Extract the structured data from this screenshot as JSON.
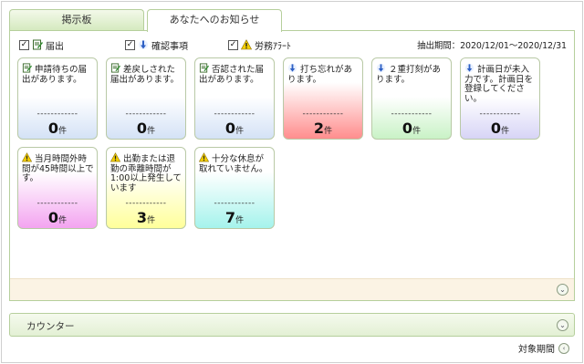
{
  "tabs": [
    {
      "label": "掲示板",
      "active": false
    },
    {
      "label": "あなたへのお知らせ",
      "active": true
    }
  ],
  "filters": [
    {
      "label": "届出",
      "checked": true,
      "icon": "notepad-icon"
    },
    {
      "label": "確認事項",
      "checked": true,
      "icon": "info-arrow-icon"
    },
    {
      "label": "労務ｱﾗｰﾄ",
      "checked": true,
      "icon": "warning-icon"
    }
  ],
  "period": "抽出期間：2020/12/01～2020/12/31",
  "cards": [
    {
      "icon": "notepad-icon",
      "message": "申請待ちの届出があります。",
      "dash": "------------",
      "count": "0",
      "unit": "件",
      "color": "#d4e2f6"
    },
    {
      "icon": "notepad-icon",
      "message": "差戻しされた届出があります。",
      "dash": "------------",
      "count": "0",
      "unit": "件",
      "color": "#d4e2f6"
    },
    {
      "icon": "notepad-icon",
      "message": "否認された届出があります。",
      "dash": "------------",
      "count": "0",
      "unit": "件",
      "color": "#d4e2f6"
    },
    {
      "icon": "info-arrow-icon",
      "message": "打ち忘れがあります。",
      "dash": "------------",
      "count": "2",
      "unit": "件",
      "color": "#ff8d8d"
    },
    {
      "icon": "info-arrow-icon",
      "message": "２重打刻があります。",
      "dash": "------------",
      "count": "0",
      "unit": "件",
      "color": "#c9f2c6"
    },
    {
      "icon": "info-arrow-icon",
      "message": "計画日が未入力です。計画日を登録してください。",
      "dash": "------------",
      "count": "0",
      "unit": "件",
      "color": "#d7d4f6"
    },
    {
      "icon": "warning-icon",
      "message": "当月時間外時間が45時間以上です。",
      "dash": "------------",
      "count": "0",
      "unit": "件",
      "color": "#f3a4f0"
    },
    {
      "icon": "warning-icon",
      "message": "出勤または退勤の乖離時間が1:00以上発生しています",
      "dash": "------------",
      "count": "3",
      "unit": "件",
      "color": "#ffff9a"
    },
    {
      "icon": "warning-icon",
      "message": "十分な休息が取れていません。",
      "dash": "------------",
      "count": "7",
      "unit": "件",
      "color": "#a5f3ec"
    }
  ],
  "counter": {
    "title": "カウンター"
  },
  "target_period": {
    "label": "対象期間"
  }
}
